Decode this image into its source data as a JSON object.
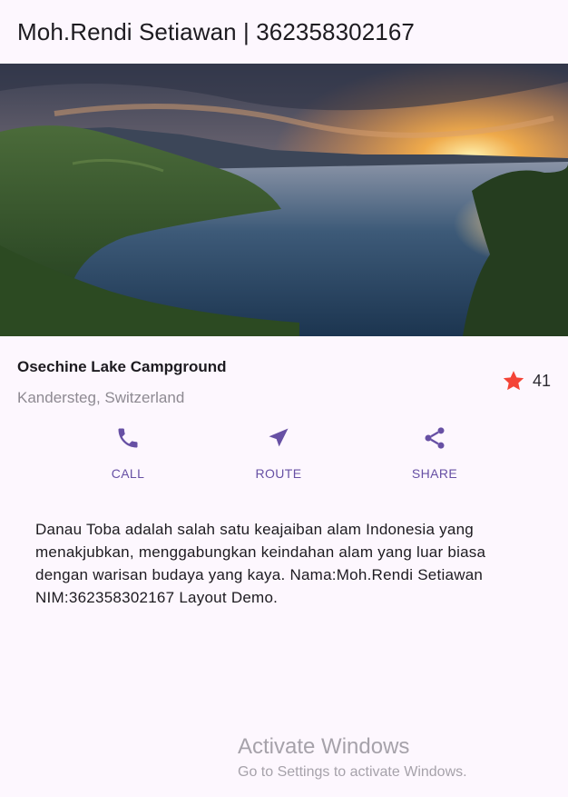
{
  "appbar": {
    "title": "Moh.Rendi Setiawan | 362358302167"
  },
  "hero": {
    "image": "lake-sunset-landscape"
  },
  "place": {
    "name": "Osechine Lake Campground",
    "location": "Kandersteg, Switzerland",
    "rating_icon": "star-icon",
    "rating_color": "#f44336",
    "rating_count": "41"
  },
  "actions": [
    {
      "label": "CALL",
      "icon": "phone-icon"
    },
    {
      "label": "ROUTE",
      "icon": "navigation-icon"
    },
    {
      "label": "SHARE",
      "icon": "share-icon"
    }
  ],
  "accent_color": "#6750a4",
  "description": "Danau Toba adalah salah satu keajaiban alam Indonesia yang menakjubkan, menggabungkan keindahan alam yang luar biasa dengan warisan budaya yang kaya. Nama:Moh.Rendi Setiawan NIM:362358302167 Layout Demo.",
  "watermark": {
    "title": "Activate Windows",
    "subtitle": "Go to Settings to activate Windows."
  }
}
